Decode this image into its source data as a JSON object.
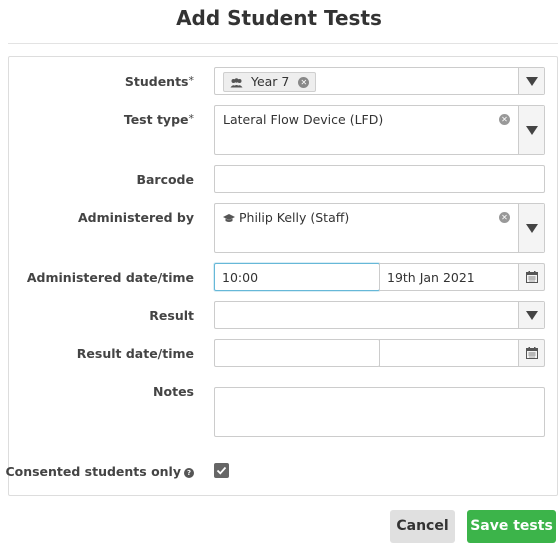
{
  "dialog": {
    "title": "Add Student Tests"
  },
  "form": {
    "students": {
      "label": "Students",
      "required_mark": "*",
      "selected_tag": "Year 7"
    },
    "test_type": {
      "label": "Test type",
      "required_mark": "*",
      "value": "Lateral Flow Device (LFD)"
    },
    "barcode": {
      "label": "Barcode",
      "value": ""
    },
    "administered_by": {
      "label": "Administered by",
      "value": "Philip Kelly (Staff)"
    },
    "administered_datetime": {
      "label": "Administered date/time",
      "time": "10:00",
      "date": "19th Jan 2021"
    },
    "result": {
      "label": "Result",
      "value": ""
    },
    "result_datetime": {
      "label": "Result date/time",
      "time": "",
      "date": ""
    },
    "notes": {
      "label": "Notes",
      "value": ""
    },
    "consented_only": {
      "label": "Consented students only",
      "checked": true
    }
  },
  "actions": {
    "cancel_label": "Cancel",
    "save_label": "Save tests"
  },
  "colors": {
    "save_button": "#3cb44a",
    "cancel_button": "#e0e0e0",
    "focus_border": "#66b8d8"
  }
}
